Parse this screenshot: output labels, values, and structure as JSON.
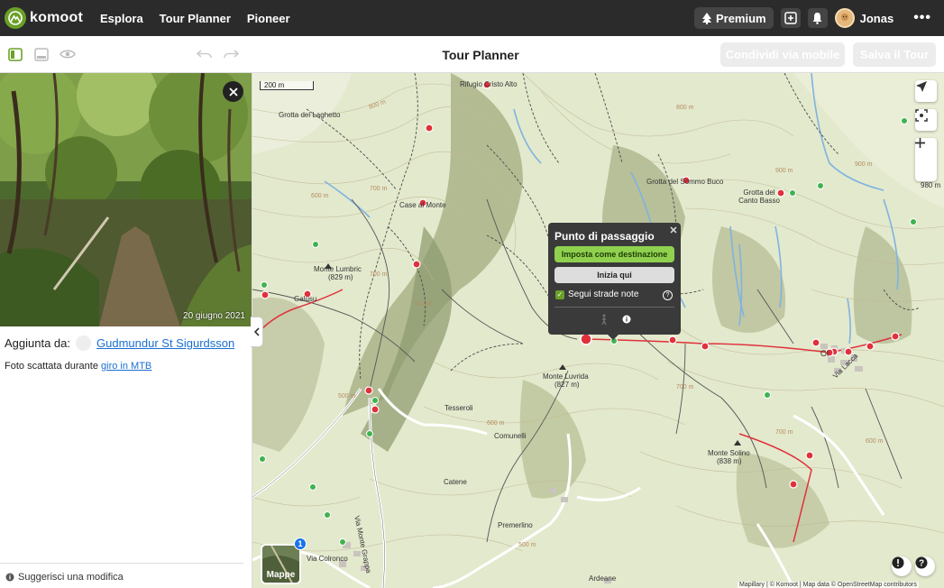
{
  "app": {
    "logo_text": "komoot",
    "nav": [
      "Esplora",
      "Tour Planner",
      "Pioneer"
    ],
    "premium_label": "Premium",
    "user_name": "Jonas",
    "more_label": "•••"
  },
  "toolbar": {
    "title": "Tour Planner",
    "share_mobile_label": "Condividi via mobile",
    "save_tour_label": "Salva il Tour"
  },
  "sidebar": {
    "photo_date": "20 giugno 2021",
    "added_by_label": "Aggiunta da:",
    "added_by_user": "Gudmundur St Sigurdsson",
    "caption_prefix": "Foto scattata durante",
    "caption_link": "giro in MTB",
    "suggest_edit": "Suggerisci una modifica"
  },
  "map": {
    "scale_label": "200 m",
    "labels": {
      "rifugio": "Rifugio Cristo Alto",
      "grotta_laghetto": "Grotta del Laghetto",
      "case_monte": "Case al Monte",
      "grotta_buco": "Grotta del Sommo Buco",
      "grotta_canto": "Grotta del Canto Basso",
      "monte_lumbric": "Monte Lumbric",
      "monte_lumbric_alt": "(829 m)",
      "galusu": "Galusu",
      "monte_luvrida": "Monte Luvrida",
      "monte_luvrida_alt": "(827 m)",
      "tesseroli": "Tesseroli",
      "comunelli": "Comunelli",
      "catene": "Catene",
      "premerlino": "Premerlino",
      "ardeane": "Ardeane",
      "monte_solino": "Monte Solino",
      "monte_solino_alt": "(838 m)",
      "via_monte_grappa": "Via Monte Grappa",
      "via_lacca": "Via Lacca",
      "via_colronco": "Via Colronco",
      "elev_980": "980 m",
      "olt": "Ol"
    },
    "attribution": "Mapillary | © Komoot | Map data © OpenStreetMap contributors",
    "layers_label": "Mappe",
    "layers_badge": "1"
  },
  "popup": {
    "title": "Punto di passaggio",
    "set_destination": "Imposta come destinazione",
    "start_here": "Inizia qui",
    "follow_roads": "Segui strade note"
  },
  "colors": {
    "brand_green": "#6aa127",
    "nav_bg": "#2b2b2b",
    "link_blue": "#1a6fd1",
    "poi_red": "#e0313b",
    "popup_bg": "#3a3a3a"
  }
}
